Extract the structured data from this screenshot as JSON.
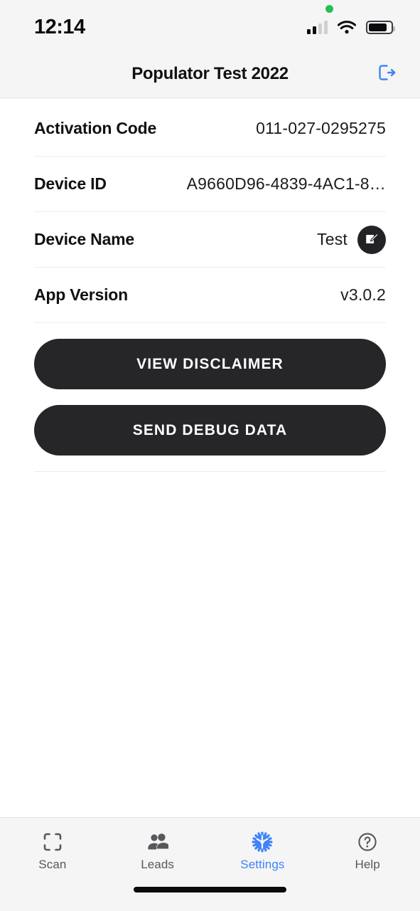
{
  "status_bar": {
    "time": "12:14",
    "recording_dot": "recording-indicator",
    "signal": "cellular-signal-icon",
    "wifi": "wifi-icon",
    "battery": "battery-icon"
  },
  "header": {
    "title": "Populator Test 2022",
    "logout_icon": "logout-icon",
    "accent_color": "#3f83f8"
  },
  "rows": [
    {
      "label": "Activation Code",
      "value": "011-027-0295275",
      "has_edit": false
    },
    {
      "label": "Device ID",
      "value": "A9660D96-4839-4AC1-8…",
      "has_edit": false
    },
    {
      "label": "Device Name",
      "value": "Test",
      "has_edit": true,
      "edit_icon": "edit-pencil-icon"
    },
    {
      "label": "App Version",
      "value": "v3.0.2",
      "has_edit": false
    }
  ],
  "actions": {
    "view_disclaimer_label": "VIEW DISCLAIMER",
    "send_debug_data_label": "SEND DEBUG DATA",
    "button_color": "#262629"
  },
  "tab_bar": {
    "active": "Settings",
    "active_color": "#3f83f8",
    "inactive_color": "#58585c",
    "items": [
      {
        "label": "Scan",
        "icon": "scan-frame-icon",
        "active": false
      },
      {
        "label": "Leads",
        "icon": "people-icon",
        "active": false
      },
      {
        "label": "Settings",
        "icon": "gear-icon",
        "active": true
      },
      {
        "label": "Help",
        "icon": "question-circle-icon",
        "active": false
      }
    ]
  }
}
